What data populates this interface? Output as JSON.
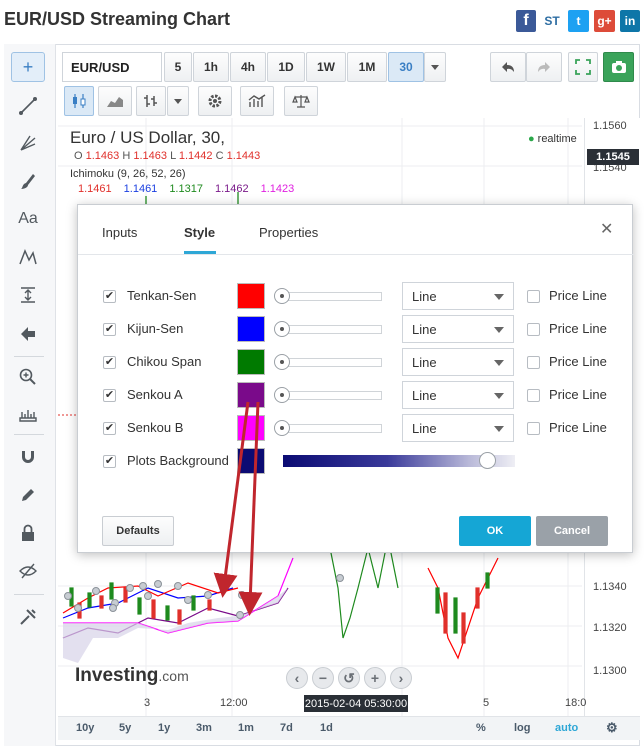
{
  "app": {
    "title": "EUR/USD Streaming Chart",
    "social": {
      "st": "ST",
      "twitter": "t",
      "gplus": "g+",
      "linkedin": "in"
    }
  },
  "toolbar": {
    "symbol": "EUR/USD",
    "timeframes": [
      "5",
      "1h",
      "4h",
      "1D",
      "1W",
      "1M",
      "30"
    ],
    "selected_timeframe": "30"
  },
  "chart": {
    "title": "Euro / US Dollar, 30,",
    "ohlc": {
      "o_label": "O",
      "o": "1.1463",
      "h_label": "H",
      "h": "1.1463",
      "l_label": "L",
      "l": "1.1442",
      "c_label": "C",
      "c": "1.1443"
    },
    "realtime_label": "realtime",
    "indicator_name": "Ichimoku (9, 26, 52, 26)",
    "indicator_values": [
      "1.1461",
      "1.1461",
      "1.1317",
      "1.1462",
      "1.1423"
    ],
    "indicator_value_colors": [
      "#e0302b",
      "#1a3ee0",
      "#1e8a1e",
      "#7a1a8a",
      "#e020e0"
    ],
    "y_labels": [
      "1.1560",
      "1.1540",
      "1.1340",
      "1.1320",
      "1.1300"
    ],
    "current_price": "1.1545",
    "x_labels": [
      "3",
      "12:00",
      "5",
      "18:0"
    ],
    "crosshair_time": "2015-02-04 05:30:00",
    "ranges": [
      "10y",
      "5y",
      "1y",
      "3m",
      "1m",
      "7d",
      "1d"
    ],
    "range_right": [
      "%",
      "log",
      "auto"
    ],
    "logo": {
      "name": "Investing",
      "suffix": ".com"
    }
  },
  "dialog": {
    "tabs": [
      "Inputs",
      "Style",
      "Properties"
    ],
    "active_tab": "Style",
    "rows": [
      {
        "label": "Tenkan-Sen",
        "color": "#ff0000",
        "style": "Line",
        "price_line": "Price Line"
      },
      {
        "label": "Kijun-Sen",
        "color": "#0000ff",
        "style": "Line",
        "price_line": "Price Line"
      },
      {
        "label": "Chikou Span",
        "color": "#007a00",
        "style": "Line",
        "price_line": "Price Line"
      },
      {
        "label": "Senkou A",
        "color": "#7a0a8a",
        "style": "Line",
        "price_line": "Price Line"
      },
      {
        "label": "Senkou B",
        "color": "#ff00ff",
        "style": "Line",
        "price_line": "Price Line"
      }
    ],
    "background_row": {
      "label": "Plots Background",
      "color": "#0b0b73"
    },
    "buttons": {
      "defaults": "Defaults",
      "ok": "OK",
      "cancel": "Cancel"
    }
  },
  "icons": {
    "left_tools": [
      "crosshair-icon",
      "trend-line-icon",
      "pitchfork-icon",
      "brush-icon",
      "text-icon",
      "pattern-icon",
      "measure-icon",
      "back-arrow-icon",
      "zoom-in-icon",
      "ruler-icon",
      "magnet-icon",
      "pencil-lock-icon",
      "lock-icon",
      "eye-hide-icon",
      "wrench-icon"
    ]
  }
}
